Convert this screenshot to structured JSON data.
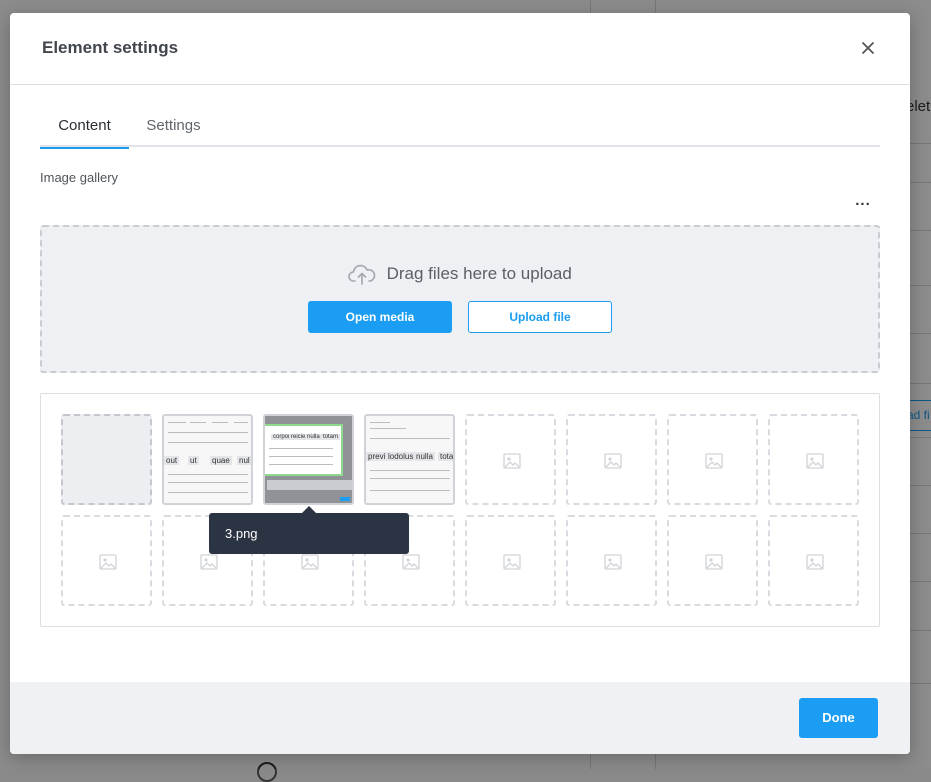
{
  "background": {
    "partial_text": "elet",
    "partial_button": "ad fi"
  },
  "modal": {
    "title": "Element settings",
    "tabs": [
      {
        "label": "Content",
        "active": true
      },
      {
        "label": "Settings",
        "active": false
      }
    ],
    "gallery": {
      "label": "Image gallery",
      "more_label": "...",
      "dropzone": {
        "text": "Drag files here to upload",
        "open_media_label": "Open media",
        "upload_file_label": "Upload file"
      },
      "thumb_words": {
        "thumb1": [
          "out",
          "ut",
          "quae",
          "nul"
        ],
        "thumb2": [
          "corpore",
          "reiciend",
          "nulla",
          "totam"
        ],
        "thumb3": [
          "previ",
          "lodolus",
          "nulla",
          "tota"
        ]
      },
      "tooltip": "3.png"
    },
    "footer": {
      "done_label": "Done"
    }
  },
  "colors": {
    "accent": "#1a9df2",
    "tooltip_bg": "#2b3443",
    "footer_bg": "#f0f1f4",
    "dropzone_bg": "#eef0f3"
  }
}
